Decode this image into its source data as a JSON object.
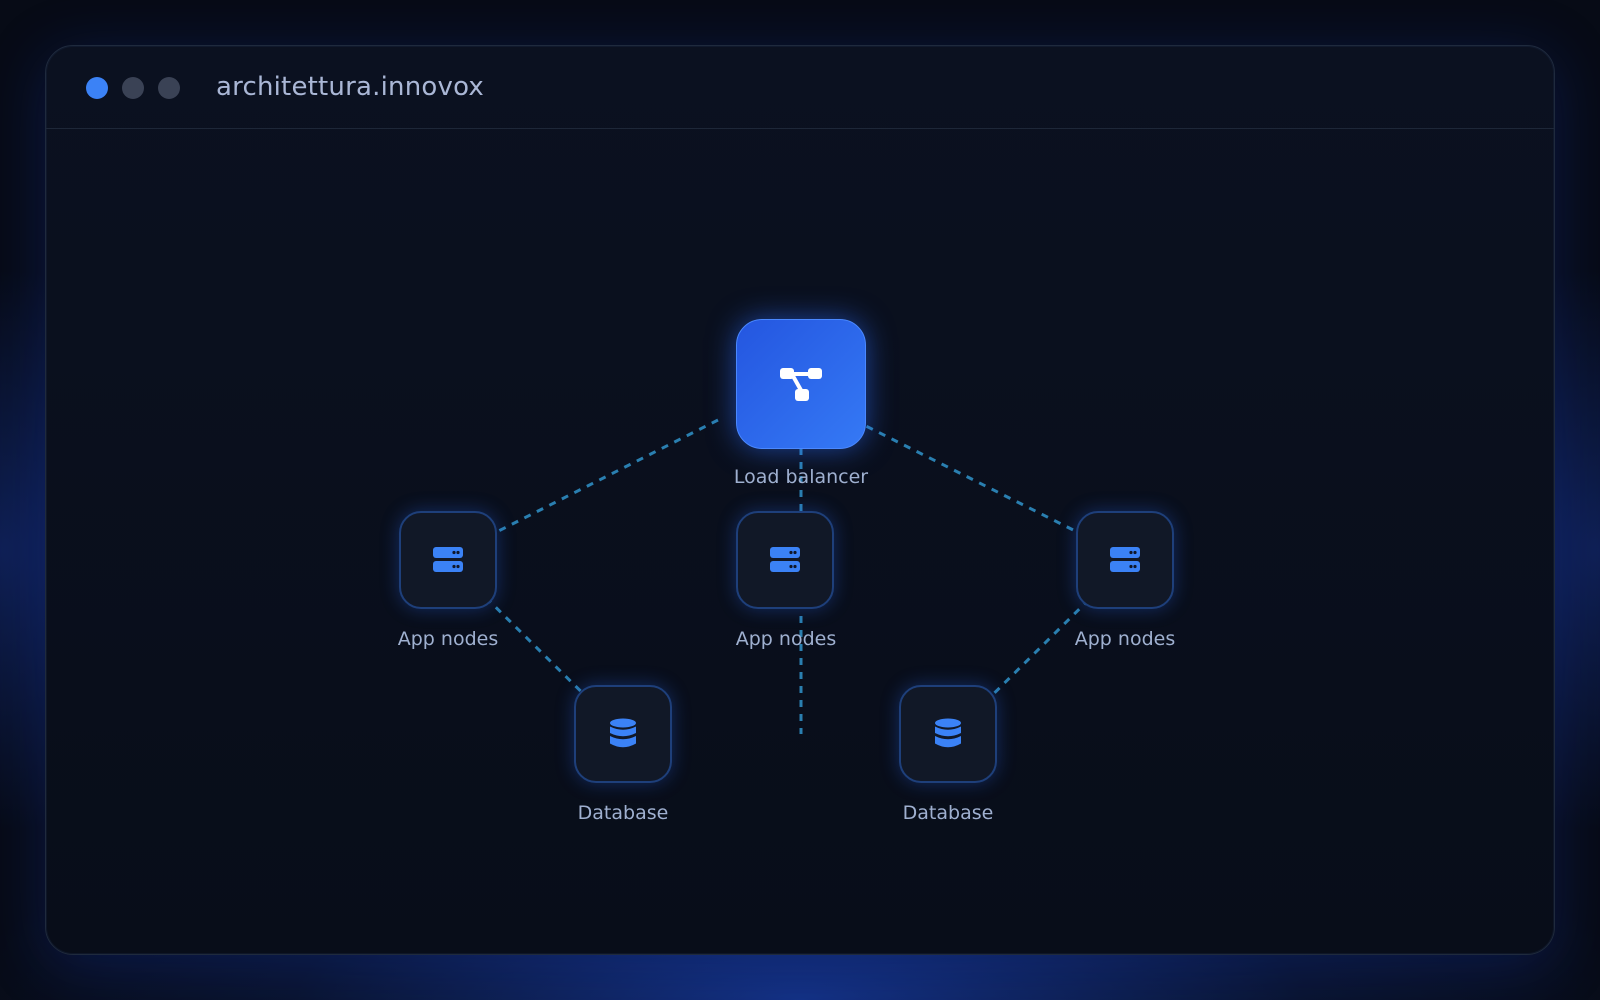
{
  "window": {
    "title": "architettura.innovox",
    "controls": [
      "close-dot",
      "minimize-dot",
      "maximize-dot"
    ]
  },
  "diagram": {
    "nodes": {
      "load_balancer": {
        "label": "Load balancer",
        "icon": "share-nodes-icon"
      },
      "app_left": {
        "label": "App nodes",
        "icon": "server-icon"
      },
      "app_center": {
        "label": "App nodes",
        "icon": "server-icon"
      },
      "app_right": {
        "label": "App nodes",
        "icon": "server-icon"
      },
      "db_left": {
        "label": "Database",
        "icon": "database-icon"
      },
      "db_right": {
        "label": "Database",
        "icon": "database-icon"
      }
    },
    "edges": [
      {
        "from": "load_balancer",
        "to": "app_left"
      },
      {
        "from": "load_balancer",
        "to": "app_center"
      },
      {
        "from": "load_balancer",
        "to": "app_right"
      },
      {
        "from": "app_left",
        "to": "db_left"
      },
      {
        "from": "app_right",
        "to": "db_right"
      }
    ]
  },
  "colors": {
    "accent": "#3b82f6",
    "link": "#2a7fb0",
    "node_border": "#1e3f7a",
    "label": "#9fb0d0"
  }
}
